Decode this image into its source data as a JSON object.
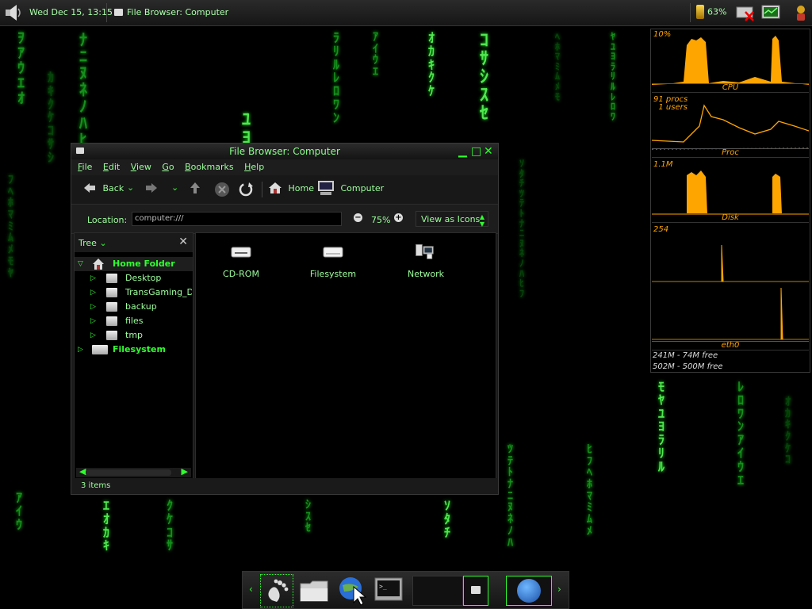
{
  "top_panel": {
    "clock": "Wed Dec 15, 13:15",
    "active_task": "File Browser: Computer",
    "battery": "63%"
  },
  "window": {
    "title": "File Browser: Computer",
    "menus": [
      {
        "u": "F",
        "rest": "ile"
      },
      {
        "u": "E",
        "rest": "dit"
      },
      {
        "u": "V",
        "rest": "iew"
      },
      {
        "u": "G",
        "rest": "o"
      },
      {
        "u": "B",
        "rest": "ookmarks"
      },
      {
        "u": "H",
        "rest": "elp"
      }
    ],
    "toolbar": {
      "back": "Back",
      "home": "Home",
      "computer": "Computer"
    },
    "location": {
      "label": "Location:",
      "value": "computer:///",
      "zoom": "75%",
      "view_mode": "View as Icons"
    },
    "sidebar": {
      "mode": "Tree",
      "items": [
        {
          "label": "Home Folder",
          "level": 0,
          "expanded": true,
          "selected": true
        },
        {
          "label": "Desktop",
          "level": 1
        },
        {
          "label": "TransGaming_Drive",
          "level": 1
        },
        {
          "label": "backup",
          "level": 1
        },
        {
          "label": "files",
          "level": 1
        },
        {
          "label": "tmp",
          "level": 1
        },
        {
          "label": "Filesystem",
          "level": 0,
          "bold": true
        }
      ]
    },
    "files": [
      {
        "label": "CD-ROM",
        "icon": "cdrom-icon"
      },
      {
        "label": "Filesystem",
        "icon": "harddrive-icon"
      },
      {
        "label": "Network",
        "icon": "network-icon"
      }
    ],
    "status": "3 items"
  },
  "sysmon": {
    "cpu": {
      "label": "CPU",
      "top": "10%"
    },
    "proc": {
      "label": "Proc",
      "top": "91 procs\n  1 users"
    },
    "disk": {
      "label": "Disk",
      "top": "1.1M"
    },
    "net": {
      "label": "eth0",
      "top": "254"
    },
    "mem": "241M - 74M free",
    "swap": "502M - 500M free"
  },
  "colors": {
    "accent": "#2fff2f",
    "graph": "#ffa500"
  }
}
